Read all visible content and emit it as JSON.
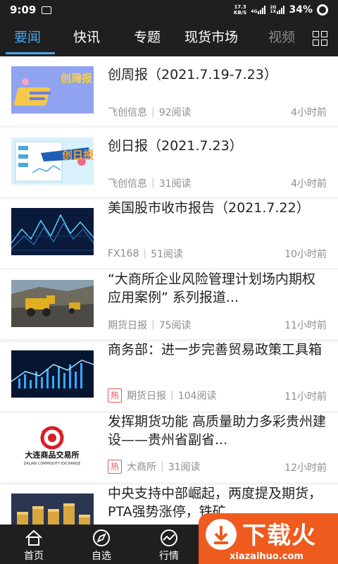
{
  "status_bar": {
    "time": "9:09",
    "net_speed_value": "17.3",
    "net_speed_unit": "KB/S",
    "signal_1_label": "4G",
    "signal_2_label": "2G",
    "signal_2_sub": "1X",
    "battery": "34%"
  },
  "tabs": [
    {
      "label": "要闻",
      "active": true
    },
    {
      "label": "快讯"
    },
    {
      "label": "专题"
    },
    {
      "label": "现货市场"
    },
    {
      "label": "视频"
    }
  ],
  "articles": [
    {
      "title": "创周报（2021.7.19-7.23）",
      "source": "飞创信息",
      "reads": "92阅读",
      "time": "4小时前",
      "hot": false,
      "thumb_text": "创周报"
    },
    {
      "title": "创日报（2021.7.23）",
      "source": "飞创信息",
      "reads": "31阅读",
      "time": "4小时前",
      "hot": false,
      "thumb_text": "创日报"
    },
    {
      "title": "美国股市收市报告（2021.7.22）",
      "source": "FX168",
      "reads": "51阅读",
      "time": "10小时前",
      "hot": false
    },
    {
      "title": "“大商所企业风险管理计划场内期权应用案例” 系列报道...",
      "source": "期货日报",
      "reads": "75阅读",
      "time": "11小时前",
      "hot": false
    },
    {
      "title": "商务部：进一步完善贸易政策工具箱",
      "source": "期货日报",
      "reads": "104阅读",
      "time": "11小时前",
      "hot": true
    },
    {
      "title": "发挥期货功能 高质量助力多彩贵州建设——贵州省副省...",
      "source": "大商所",
      "reads": "31阅读",
      "time": "12小时前",
      "hot": true,
      "thumb_text": "大连商品交易所",
      "thumb_sub": "DALIAN COMMODITY EXCHANGE"
    },
    {
      "title": "中央支持中部崛起，两度提及期货，PTA强势涨停，铁矿...",
      "source": "",
      "reads": "",
      "time": "",
      "hot": false
    }
  ],
  "hot_label": "热",
  "bottom_nav": [
    {
      "label": "首页",
      "icon": "home-icon"
    },
    {
      "label": "自选",
      "icon": "compass-icon"
    },
    {
      "label": "行情",
      "icon": "chart-icon"
    }
  ],
  "watermark": {
    "main": "下载火",
    "sub": "xiazaihuo.com"
  },
  "colors": {
    "accent": "#4aa3e8",
    "bar_bg": "#1f1f1f",
    "hot": "#e05a5a",
    "watermark": "#ef5a1e"
  }
}
